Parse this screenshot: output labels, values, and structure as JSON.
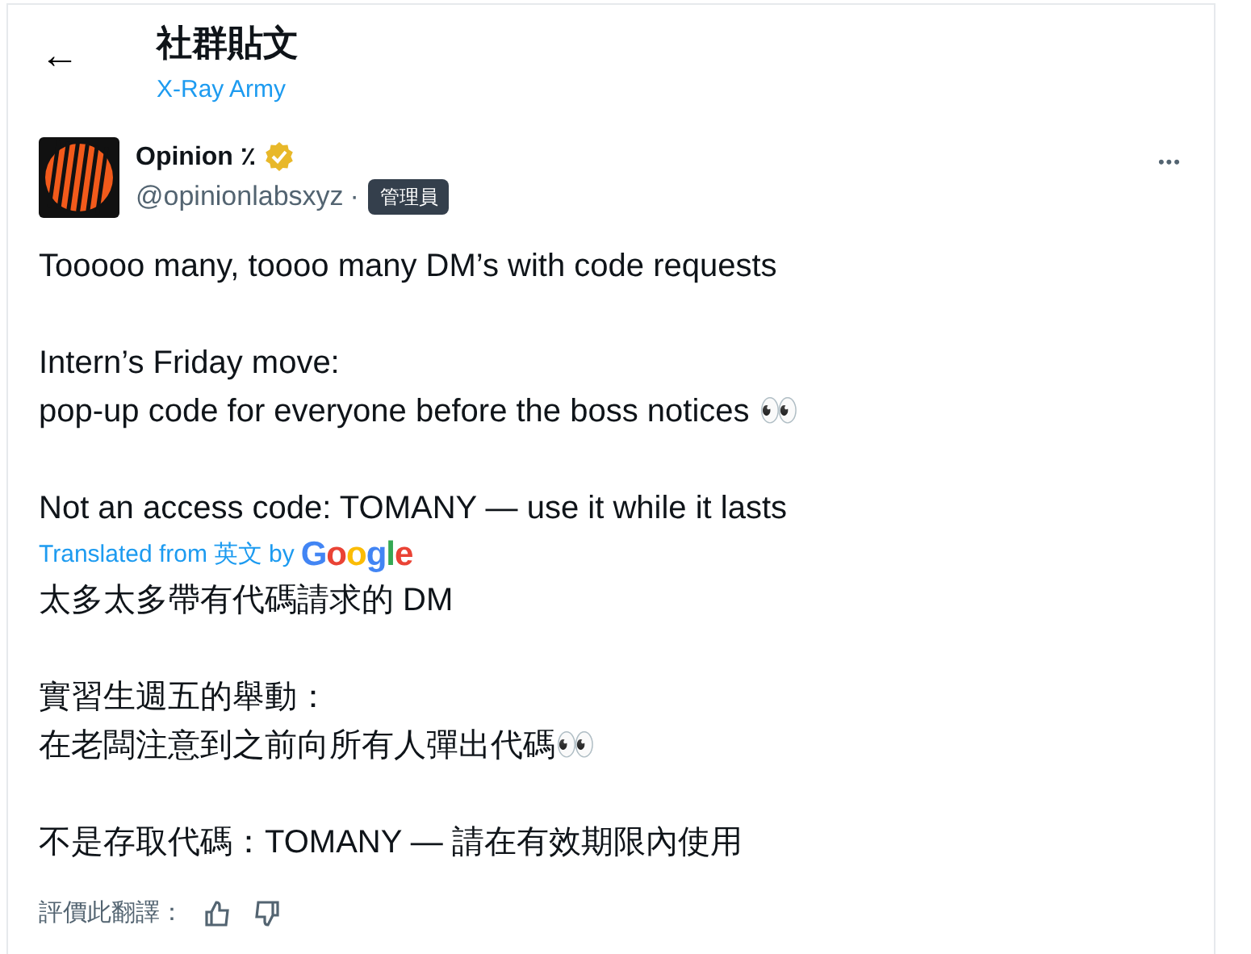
{
  "header": {
    "back_icon": "←",
    "title": "社群貼文",
    "community": "X-Ray Army"
  },
  "post": {
    "author": {
      "name": "Opinion ٪",
      "verified": true,
      "handle": "@opinionlabsxyz",
      "separator": "·",
      "role_badge": "管理員"
    },
    "more": "•••",
    "paragraphs": [
      [
        "Tooooo many, toooo many DM’s with code requests"
      ],
      [
        "Intern’s Friday move:",
        "pop-up code for everyone before the boss notices 👀"
      ],
      [
        "Not an access code: TOMANY — use it while it lasts"
      ]
    ],
    "translation": {
      "prefix": "Translated from",
      "source_language": "英文",
      "by": "by",
      "provider": "Google"
    },
    "translated_paragraphs": [
      [
        "太多太多帶有代碼請求的 DM"
      ],
      [
        "實習生週五的舉動：",
        "在老闆注意到之前向所有人彈出代碼👀"
      ],
      [
        "不是存取代碼：TOMANY — 請在有效期限內使用"
      ]
    ],
    "rate_label": "評價此翻譯："
  }
}
